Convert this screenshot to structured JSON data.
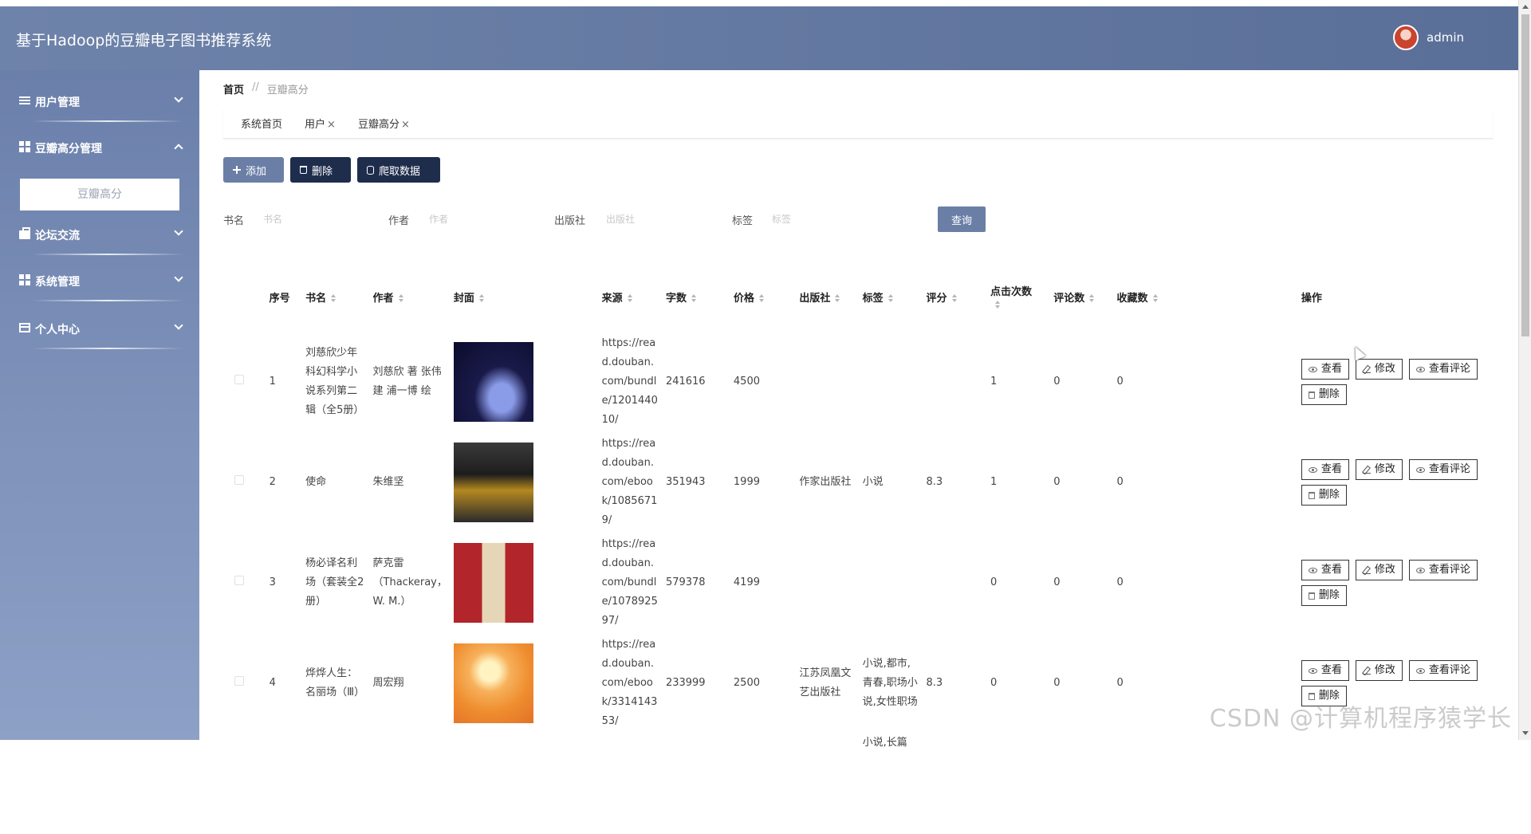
{
  "header": {
    "title": "基于Hadoop的豆瓣电子图书推荐系统",
    "username": "admin"
  },
  "sidebar": {
    "items": [
      {
        "label": "用户管理",
        "icon": "sliders-icon"
      },
      {
        "label": "豆瓣高分管理",
        "icon": "grid-icon"
      },
      {
        "label": "论坛交流",
        "icon": "briefcase-icon"
      },
      {
        "label": "系统管理",
        "icon": "grid-icon"
      },
      {
        "label": "个人中心",
        "icon": "id-card-icon"
      }
    ],
    "subitem": "豆瓣高分"
  },
  "breadcrumb": {
    "home": "首页",
    "separator": "//",
    "current": "豆瓣高分"
  },
  "tabs": [
    {
      "label": "系统首页",
      "closable": ""
    },
    {
      "label": "用户",
      "closable": "×"
    },
    {
      "label": "豆瓣高分",
      "closable": "×"
    }
  ],
  "toolbar": {
    "add": "添加",
    "delete": "删除",
    "crawl": "爬取数据"
  },
  "search": {
    "fields": [
      {
        "label": "书名",
        "placeholder": "书名"
      },
      {
        "label": "作者",
        "placeholder": "作者"
      },
      {
        "label": "出版社",
        "placeholder": "出版社"
      },
      {
        "label": "标签",
        "placeholder": "标签"
      }
    ],
    "button": "查询"
  },
  "table": {
    "headers": [
      "序号",
      "书名",
      "作者",
      "封面",
      "来源",
      "字数",
      "价格",
      "出版社",
      "标签",
      "评分",
      "点击次数",
      "评论数",
      "收藏数",
      "操作"
    ],
    "rows": [
      {
        "no": "1",
        "name": "刘慈欣少年科幻科学小说系列第二辑（全5册）",
        "author": "刘慈欣 著 张伟建 浦一博 绘",
        "source": "https://read.douban.com/bundle/120144010/",
        "words": "241616",
        "price": "4500",
        "publisher": "",
        "tags": "",
        "score": "",
        "clicks": "1",
        "comments": "0",
        "favs": "0"
      },
      {
        "no": "2",
        "name": "使命",
        "author": "朱维坚",
        "source": "https://read.douban.com/ebook/10856719/",
        "words": "351943",
        "price": "1999",
        "publisher": "作家出版社",
        "tags": "小说",
        "score": "8.3",
        "clicks": "1",
        "comments": "0",
        "favs": "0"
      },
      {
        "no": "3",
        "name": "杨必译名利场（套装全2册）",
        "author": "萨克雷（Thackeray，W. M.）",
        "source": "https://read.douban.com/bundle/107892597/",
        "words": "579378",
        "price": "4199",
        "publisher": "",
        "tags": "",
        "score": "",
        "clicks": "0",
        "comments": "0",
        "favs": "0"
      },
      {
        "no": "4",
        "name": "烨烨人生：名丽场（Ⅲ）",
        "author": "周宏翔",
        "source": "https://read.douban.com/ebook/331414353/",
        "words": "233999",
        "price": "2500",
        "publisher": "江苏凤凰文艺出版社",
        "tags": "小说,都市,青春,职场小说,女性职场",
        "score": "8.3",
        "clicks": "0",
        "comments": "0",
        "favs": "0"
      }
    ],
    "partial_row_tags": "小说,长篇",
    "ops": {
      "view": "查看",
      "edit": "修改",
      "view_comments": "查看评论",
      "delete": "删除"
    }
  },
  "watermark": "CSDN @计算机程序猿学长"
}
